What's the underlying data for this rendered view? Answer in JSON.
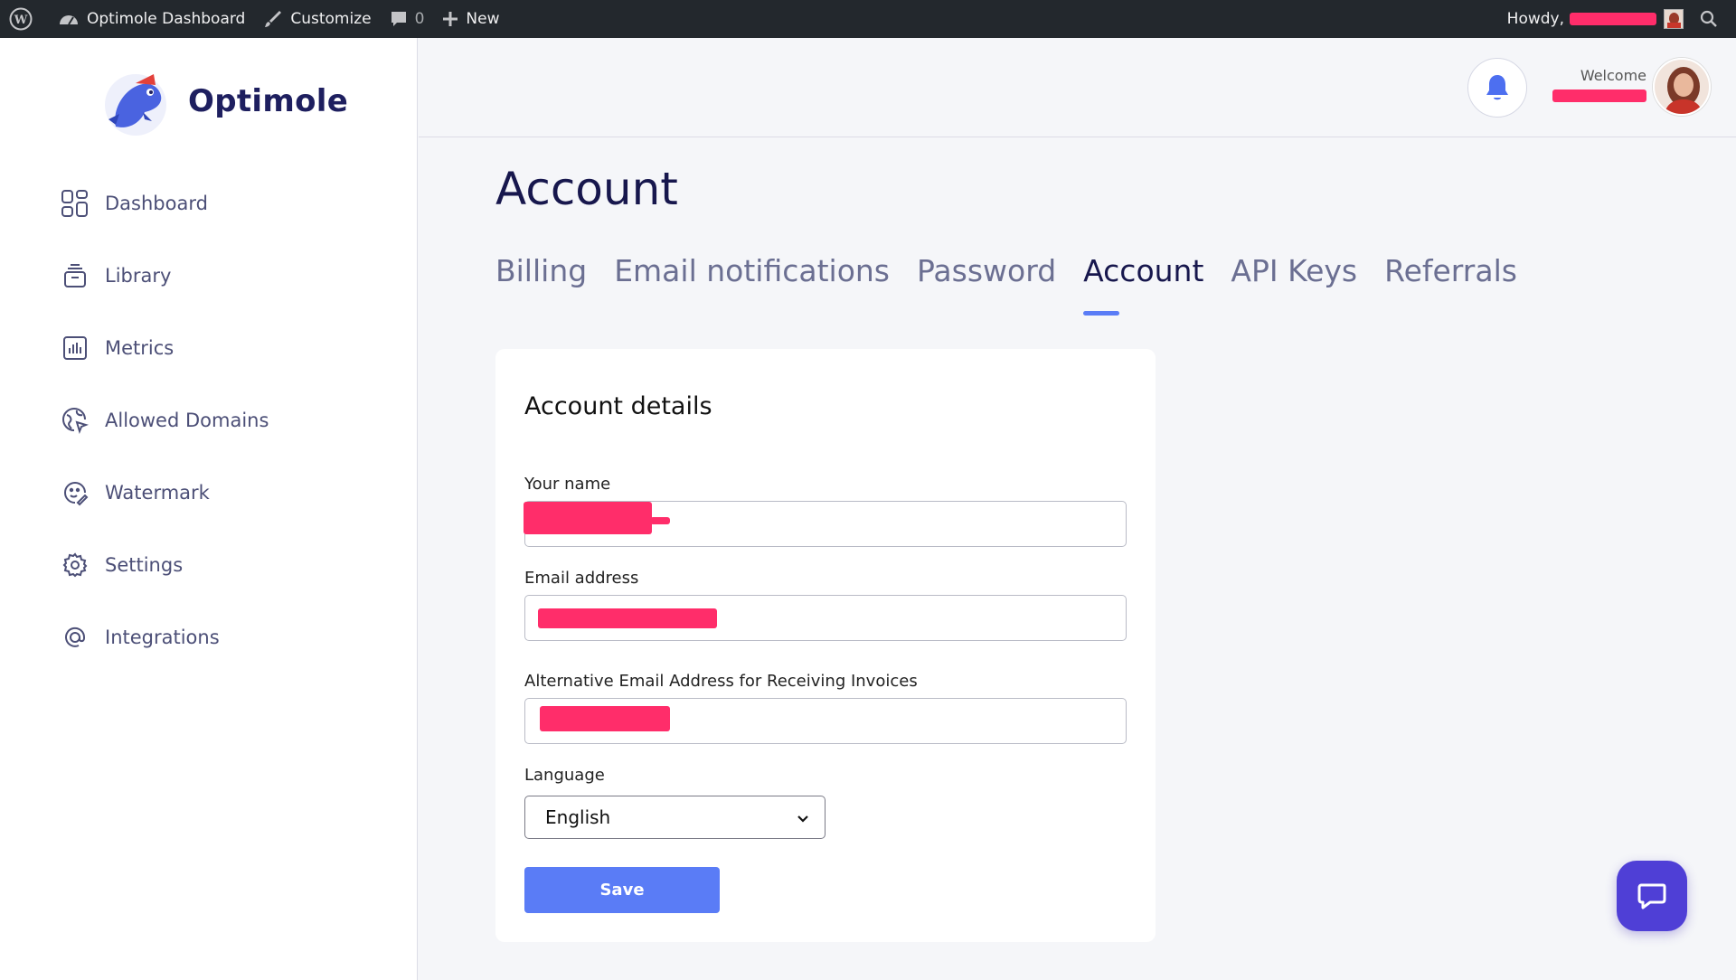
{
  "adminbar": {
    "site_name": "Optimole Dashboard",
    "customize": "Customize",
    "comments_count": "0",
    "new_label": "New",
    "howdy": "Howdy,"
  },
  "sidebar": {
    "brand": "Optimole",
    "items": [
      {
        "label": "Dashboard",
        "icon": "grid-icon"
      },
      {
        "label": "Library",
        "icon": "library-icon"
      },
      {
        "label": "Metrics",
        "icon": "bar-chart-icon"
      },
      {
        "label": "Allowed Domains",
        "icon": "globe-cursor-icon"
      },
      {
        "label": "Watermark",
        "icon": "watermark-icon"
      },
      {
        "label": "Settings",
        "icon": "gear-icon"
      },
      {
        "label": "Integrations",
        "icon": "at-icon"
      }
    ]
  },
  "header": {
    "welcome": "Welcome"
  },
  "page": {
    "title": "Account",
    "tabs": [
      {
        "label": "Billing",
        "active": false
      },
      {
        "label": "Email notifications",
        "active": false
      },
      {
        "label": "Password",
        "active": false
      },
      {
        "label": "Account",
        "active": true
      },
      {
        "label": "API Keys",
        "active": false
      },
      {
        "label": "Referrals",
        "active": false
      }
    ]
  },
  "form": {
    "title": "Account details",
    "name_label": "Your name",
    "email_label": "Email address",
    "alt_email_label": "Alternative Email Address for Receiving Invoices",
    "language_label": "Language",
    "language_value": "English",
    "save_label": "Save"
  },
  "colors": {
    "accent": "#5a7cf6",
    "chat": "#4f3fd6",
    "redaction": "#ff2d6a",
    "adminbar": "#23282d"
  }
}
